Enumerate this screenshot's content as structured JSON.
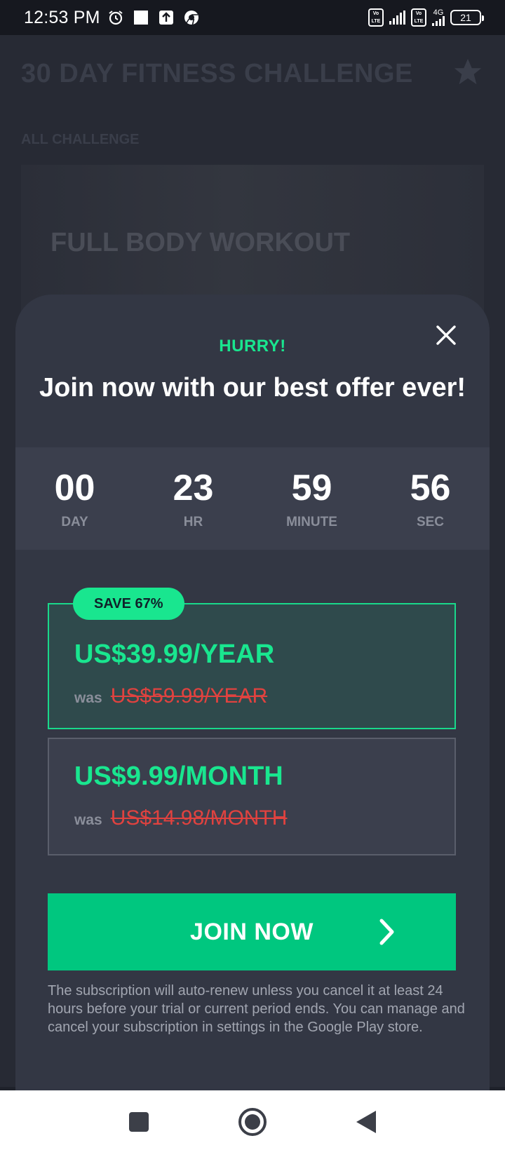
{
  "status_bar": {
    "time": "12:53 PM",
    "volte1": "Vo LTE",
    "volte2": "Vo LTE",
    "network": "4G",
    "battery": "21"
  },
  "background": {
    "title": "30 DAY FITNESS CHALLENGE",
    "section": "ALL CHALLENGE",
    "card_title": "FULL BODY WORKOUT"
  },
  "offer": {
    "hurry": "HURRY!",
    "headline": "Join now with our best offer ever!",
    "countdown": [
      {
        "value": "00",
        "label": "DAY"
      },
      {
        "value": "23",
        "label": "HR"
      },
      {
        "value": "59",
        "label": "MINUTE"
      },
      {
        "value": "56",
        "label": "SEC"
      }
    ],
    "plans": [
      {
        "badge": "SAVE 67%",
        "price": "US$39.99/YEAR",
        "was_label": "was",
        "old_price": "US$59.99/YEAR",
        "selected": true
      },
      {
        "price": "US$9.99/MONTH",
        "was_label": "was",
        "old_price": "US$14.98/MONTH",
        "selected": false
      }
    ],
    "cta": "JOIN NOW",
    "legal": "The subscription will auto-renew unless you cancel it at least 24 hours before your trial or current period ends. You can manage and cancel your subscription in settings in the Google Play store."
  },
  "colors": {
    "accent": "#19e68f",
    "cta_bg": "#00c77f",
    "old_price": "#e0423f",
    "sheet_bg": "#333744"
  },
  "icons": {
    "close": "close-icon",
    "star": "star-icon",
    "arrow": "chevron-right-icon",
    "nav_recents": "square-icon",
    "nav_home": "circle-icon",
    "nav_back": "triangle-back-icon"
  }
}
